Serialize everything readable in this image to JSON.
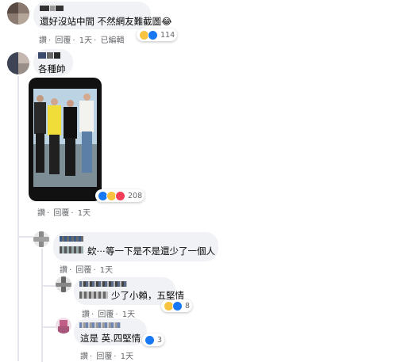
{
  "comments": [
    {
      "text": "還好沒站中間 不然網友難截圖😂",
      "actions": {
        "like": "讚",
        "reply": "回覆",
        "time": "1天",
        "edited": "已編輯"
      },
      "reactions": {
        "icons": [
          "haha-icon",
          "like-icon"
        ],
        "count": "114"
      }
    },
    {
      "text": "各種帥",
      "actions": {
        "like": "讚",
        "reply": "回覆",
        "time": "1天"
      },
      "reactions": {
        "icons": [
          "like-icon",
          "haha-icon",
          "love-icon"
        ],
        "count": "208"
      },
      "replies": [
        {
          "text": "欸⋯等一下是不是還少了一個人",
          "actions": {
            "like": "讚",
            "reply": "回覆",
            "time": "1天"
          },
          "replies": [
            {
              "text": "少了小賴，五堅情",
              "actions": {
                "like": "讚",
                "reply": "回覆",
                "time": "1天"
              },
              "reactions": {
                "icons": [
                  "haha-icon",
                  "like-icon"
                ],
                "count": "8"
              }
            },
            {
              "text": "這是 英.四堅情",
              "actions": {
                "like": "讚",
                "reply": "回覆",
                "time": "1天"
              },
              "reactions": {
                "icons": [
                  "like-icon"
                ],
                "count": "3"
              }
            }
          ]
        }
      ]
    }
  ],
  "colors": {
    "bubble": "#f0f2f5",
    "meta": "#65676b",
    "like": "#1877f2",
    "haha": "#f7c341",
    "love": "#f33e58"
  }
}
